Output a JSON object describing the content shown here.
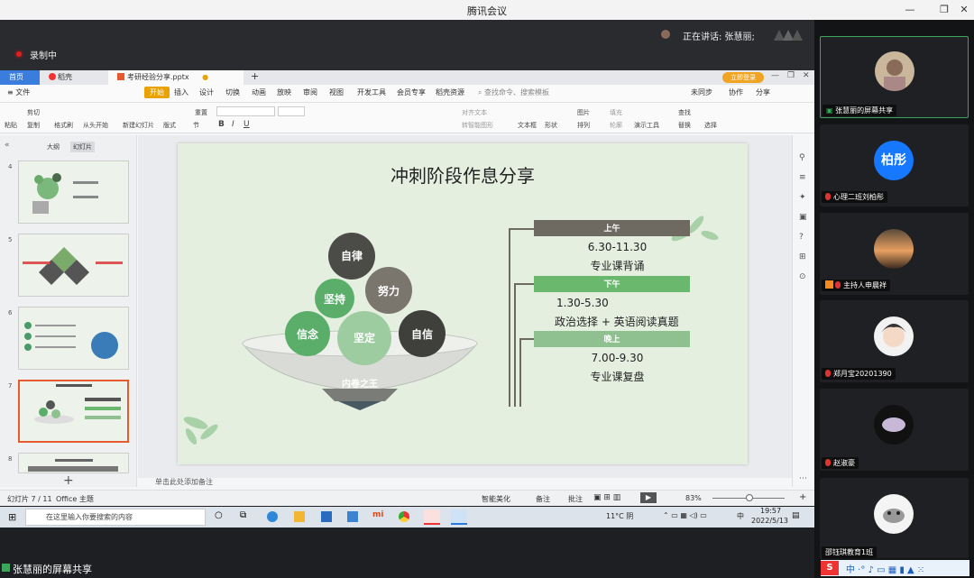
{
  "window": {
    "title": "腾讯会议"
  },
  "meeting": {
    "recording_label": "录制中",
    "speaking_label": "正在讲话: 张慧丽;",
    "share_label": "张慧丽的屏幕共享"
  },
  "ppt": {
    "tabs": [
      "首页",
      "稻壳",
      "考研经验分享.pptx"
    ],
    "menu": [
      "文件",
      "开始",
      "插入",
      "设计",
      "切换",
      "动画",
      "放映",
      "审阅",
      "视图",
      "开发工具",
      "会员专享",
      "稻壳资源"
    ],
    "search_placeholder": "查找命令、搜索模板",
    "right_menu": [
      "未同步",
      "协作",
      "分享"
    ],
    "login_btn": "立即登录",
    "ribbon": {
      "cut": "剪切",
      "copy": "复制",
      "paste": "粘贴",
      "format_painter": "格式刷",
      "from_start": "从头开始",
      "new_slide": "新建幻灯片",
      "layout": "版式",
      "section": "节",
      "reset": "重置",
      "textbox": "文本框",
      "shape": "形状",
      "arrange": "排列",
      "picture": "图片",
      "fill": "填充",
      "outline": "轮廓",
      "present_tools": "演示工具",
      "find": "查找",
      "replace": "替换",
      "select": "选择",
      "align_text": "对齐文本",
      "convert_smart": "转智能图形"
    },
    "pane_tabs": [
      "大纲",
      "幻灯片"
    ],
    "thumb_numbers": [
      "4",
      "5",
      "6",
      "7",
      "8"
    ],
    "notes_placeholder": "单击此处添加备注",
    "status": {
      "slide_pos": "幻灯片 7 / 11",
      "theme": "Office 主题",
      "beautify": "智能美化",
      "notes": "备注",
      "comments": "批注",
      "zoom": "83%"
    }
  },
  "slide": {
    "title": "冲刺阶段作息分享",
    "circles": [
      "自律",
      "坚持",
      "努力",
      "信念",
      "坚定",
      "自信"
    ],
    "bowl_label": "内卷之王",
    "morning": {
      "header": "上午",
      "time": "6.30-11.30",
      "task": "专业课背诵"
    },
    "afternoon": {
      "header": "下午",
      "time": "1.30-5.30",
      "task": "政治选择 + 英语阅读真题"
    },
    "evening": {
      "header": "晚上",
      "time": "7.00-9.30",
      "task": "专业课复盘"
    }
  },
  "taskbar": {
    "search_placeholder": "在这里输入你要搜索的内容",
    "weather": "11°C 阴",
    "ime": "中",
    "time": "19:57",
    "date": "2022/5/13"
  },
  "participants": [
    {
      "name": "张慧丽的屏幕共享"
    },
    {
      "name": "心理二班刘柏彤",
      "initials": "柏彤"
    },
    {
      "name": "主持人申晨祥"
    },
    {
      "name": "郑月宝20201390"
    },
    {
      "name": "赵淑豪"
    },
    {
      "name": "邵钰琪教育1班"
    }
  ],
  "colors": {
    "accent_green": "#6ab86d",
    "dark_header": "#6e6a62",
    "circle_dark": "#4b4c47",
    "blue_avatar": "#1677ff"
  }
}
